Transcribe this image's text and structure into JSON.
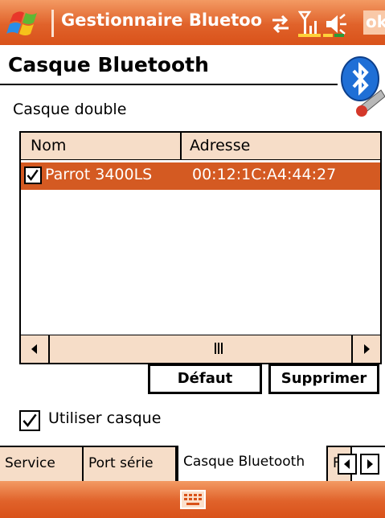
{
  "titlebar": {
    "title": "Gestionnaire Bluetoo",
    "ok_label": "ok",
    "icons": [
      "windows-start-icon",
      "connectivity-icon",
      "signal-icon",
      "volume-icon"
    ]
  },
  "page": {
    "title": "Casque Bluetooth",
    "section_label": "Casque double"
  },
  "listview": {
    "columns": [
      "Nom",
      "Adresse"
    ],
    "rows": [
      {
        "checked": true,
        "name": "Parrot 3400LS",
        "address": "00:12:1C:A4:44:27"
      }
    ]
  },
  "buttons": {
    "default_label": "Défaut",
    "delete_label": "Supprimer"
  },
  "options": {
    "use_headset_label": "Utiliser casque",
    "use_headset_checked": true
  },
  "tabs": [
    {
      "label": "Service",
      "active": false
    },
    {
      "label": "Port série",
      "active": false
    },
    {
      "label": "Casque Bluetooth",
      "active": true
    },
    {
      "label": "F",
      "active": false
    }
  ],
  "colors": {
    "titlebar_orange": "#e0622a",
    "selection": "#d45a22",
    "panel_beige": "#f6ddc8"
  }
}
